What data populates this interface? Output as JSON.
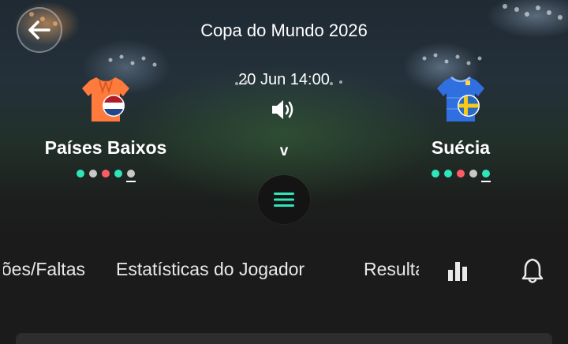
{
  "header": {
    "competition": "Copa do Mundo 2026",
    "datetime": "20 Jun 14:00",
    "separator": "v"
  },
  "icons": {
    "back": "arrow-left-icon",
    "sound": "speaker-icon",
    "menu": "hamburger-menu-icon",
    "stats": "bar-chart-icon",
    "bell": "bell-icon"
  },
  "home_team": {
    "name": "Países Baixos",
    "shirt_color": "#ff7a3d",
    "form": [
      "#2ee6b8",
      "#c9c9c9",
      "#ff5a66",
      "#2ee6b8",
      "#c9c9c9"
    ]
  },
  "away_team": {
    "name": "Suécia",
    "shirt_color": "#2f6fe0",
    "form": [
      "#2ee6b8",
      "#2ee6b8",
      "#ff5a66",
      "#c9c9c9",
      "#2ee6b8"
    ]
  },
  "tabs": [
    {
      "label": "Cartões/Faltas"
    },
    {
      "label": "Estatísticas do Jogador"
    },
    {
      "label": "Resultados"
    }
  ],
  "colors": {
    "accent": "#2ee6b8",
    "loss": "#ff5a66",
    "draw": "#c9c9c9",
    "background": "#1b1b1b"
  }
}
